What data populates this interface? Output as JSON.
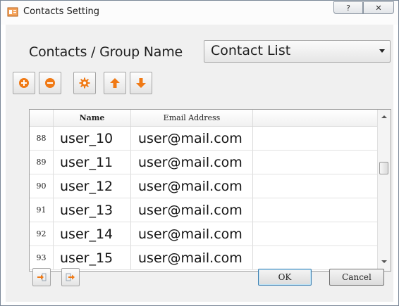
{
  "window": {
    "title": "Contacts Setting",
    "help_glyph": "?",
    "close_glyph": "✕"
  },
  "group": {
    "label": "Contacts / Group Name",
    "selected": "Contact List"
  },
  "toolbar": {
    "icons": [
      "add-icon",
      "remove-icon",
      "gear-icon",
      "arrow-up-icon",
      "arrow-down-icon"
    ],
    "icon_color": "#f07a16"
  },
  "table": {
    "columns": [
      "Name",
      "Email Address"
    ],
    "rows": [
      {
        "num": "88",
        "name": "user_10",
        "email": "user@mail.com"
      },
      {
        "num": "89",
        "name": "user_11",
        "email": "user@mail.com"
      },
      {
        "num": "90",
        "name": "user_12",
        "email": "user@mail.com"
      },
      {
        "num": "91",
        "name": "user_13",
        "email": "user@mail.com"
      },
      {
        "num": "92",
        "name": "user_14",
        "email": "user@mail.com"
      },
      {
        "num": "93",
        "name": "user_15",
        "email": "user@mail.com"
      }
    ]
  },
  "bottom": {
    "import_icon": "import-icon",
    "export_icon": "export-icon",
    "ok": "OK",
    "cancel": "Cancel"
  }
}
